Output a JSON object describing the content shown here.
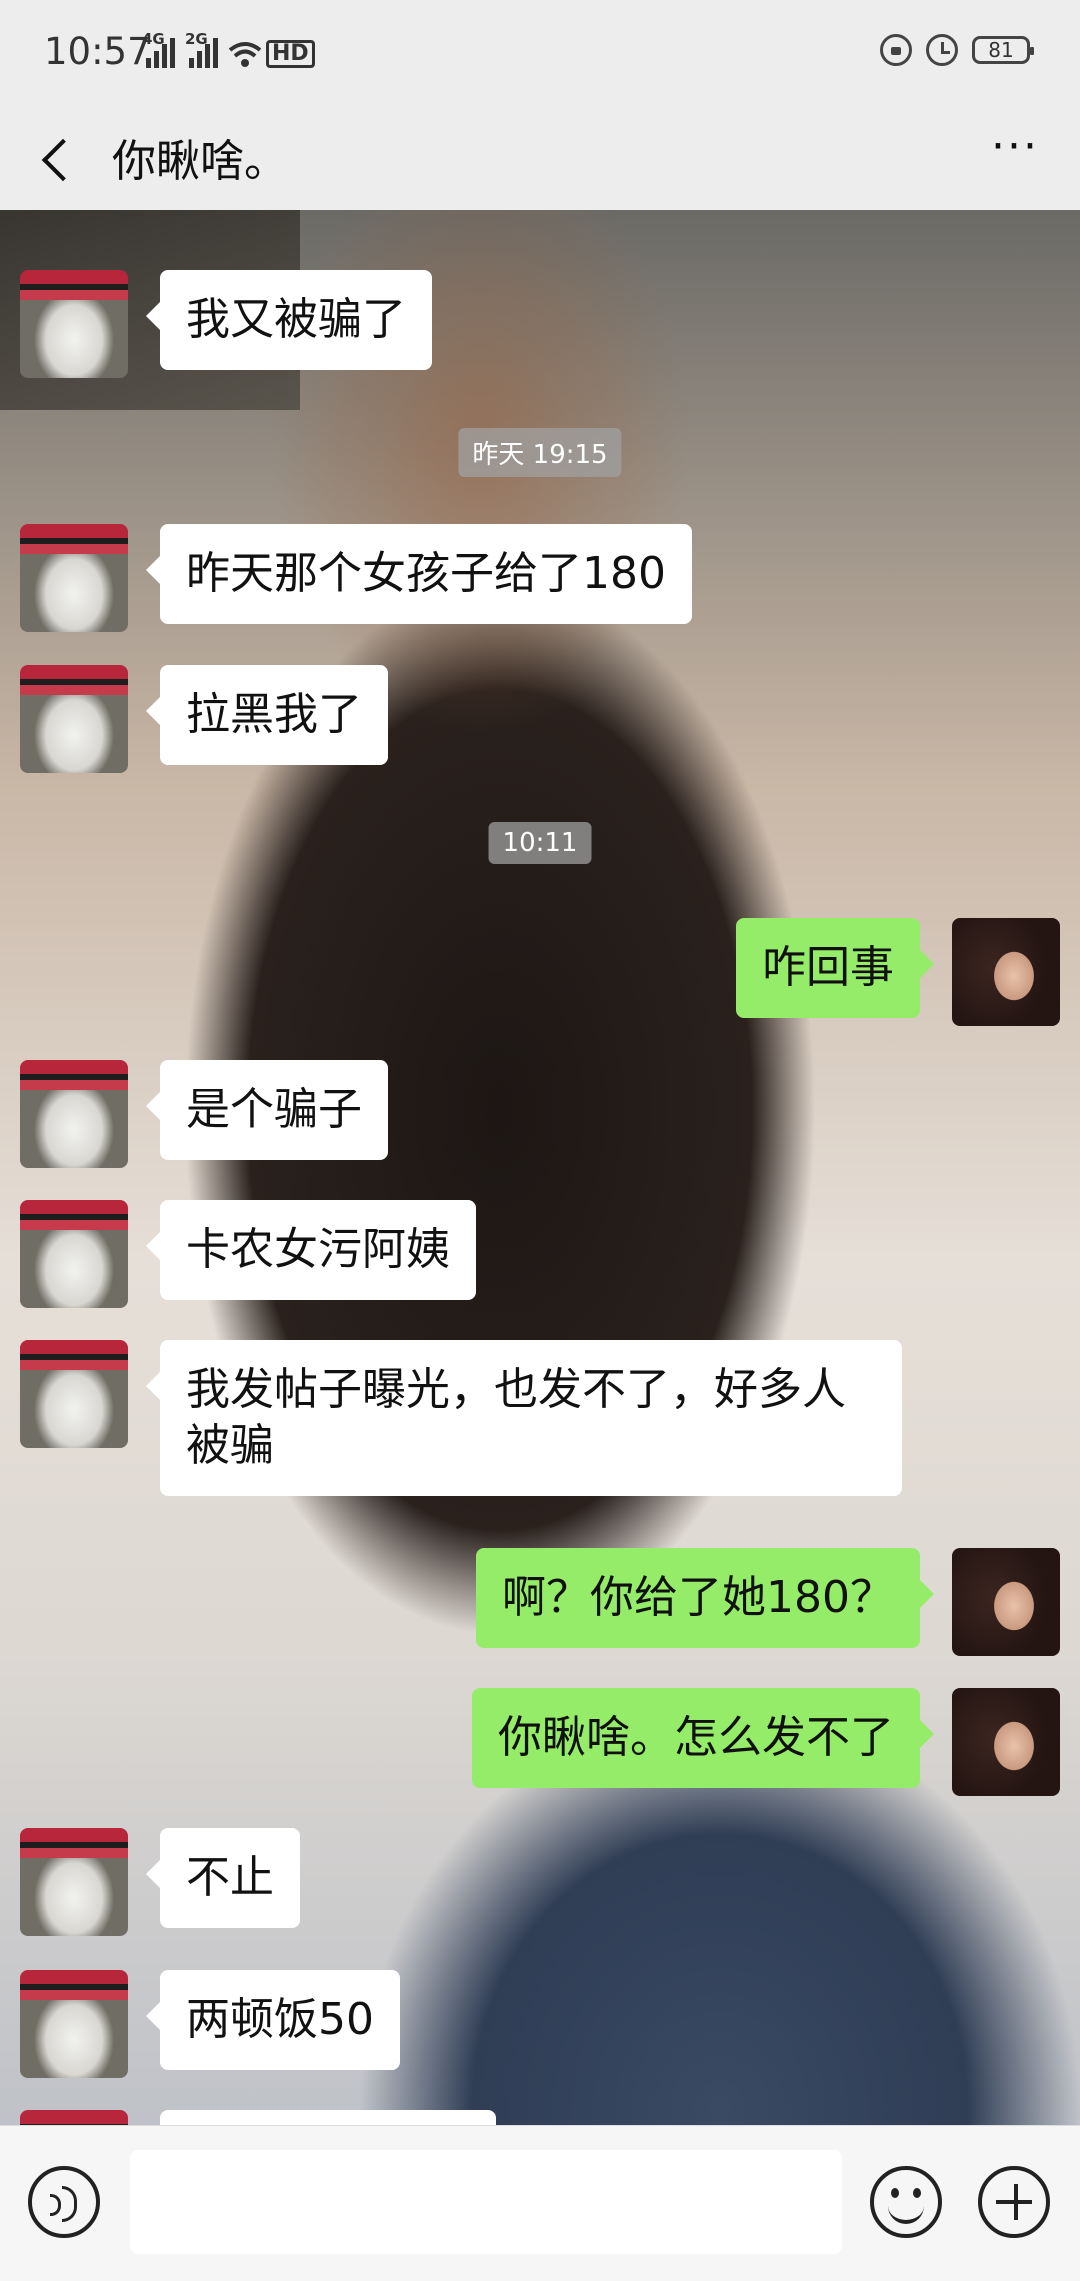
{
  "status_bar": {
    "time": "10:57",
    "net1": "4G",
    "net2": "2G",
    "hd": "HD",
    "battery": "81"
  },
  "header": {
    "title": "你瞅啥。",
    "more": "···"
  },
  "messages": [
    {
      "text": "我又被骗了"
    },
    {
      "timestamp": "昨天 19:15"
    },
    {
      "text": "昨天那个女孩子给了180"
    },
    {
      "text": "拉黑我了"
    },
    {
      "timestamp": "10:11"
    },
    {
      "text": "咋回事"
    },
    {
      "text": "是个骗子"
    },
    {
      "text": "卡农女污阿姨"
    },
    {
      "text": "我发帖子曝光，也发不了，好多人被骗"
    },
    {
      "text": "啊？你给了她180？"
    },
    {
      "text": "你瞅啥。怎么发不了"
    },
    {
      "text": "不止"
    },
    {
      "text": "两顿饭50"
    }
  ],
  "input": {
    "placeholder": ""
  },
  "icons": {
    "back": "back-arrow-icon",
    "more": "more-icon",
    "voice": "voice-icon",
    "emoji": "emoji-icon",
    "plus": "plus-icon"
  },
  "colors": {
    "my_bubble": "#95ec69",
    "their_bubble": "#ffffff",
    "header_bg": "#ededed"
  }
}
